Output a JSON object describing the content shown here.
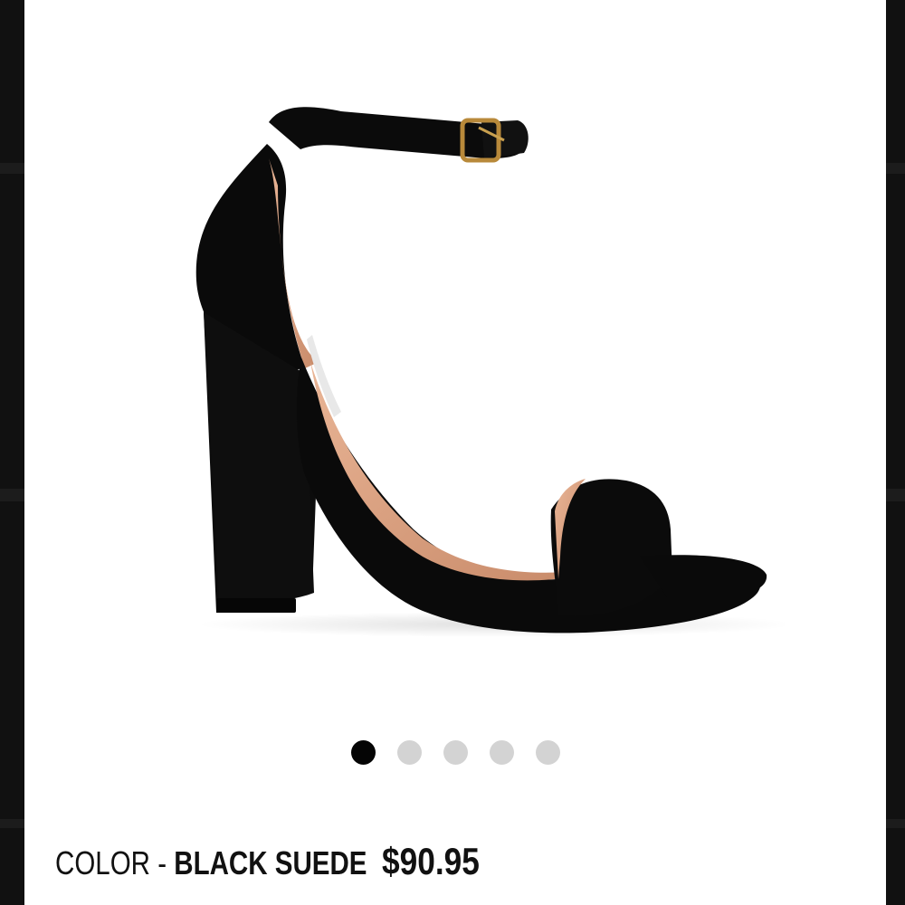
{
  "product": {
    "color_label": "COLOR",
    "color_separator": "-",
    "color_value": "BLACK SUEDE",
    "price": "$90.95",
    "image_icon": "black-suede-block-heel-sandal"
  },
  "gallery": {
    "count": 5,
    "active_index": 0
  },
  "colors": {
    "background": "#ffffff",
    "dot_active": "#050505",
    "dot_inactive": "#d3d3d3",
    "side_edges": "#111111"
  }
}
